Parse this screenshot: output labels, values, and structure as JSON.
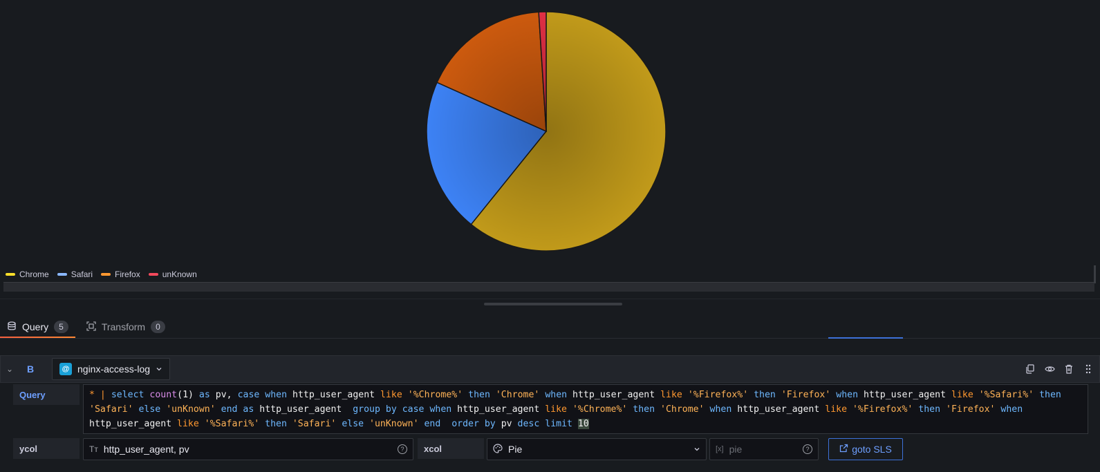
{
  "chart_data": {
    "type": "pie",
    "series": [
      {
        "name": "Chrome",
        "value": 60.8,
        "color": "#c19a1a"
      },
      {
        "name": "Safari",
        "value": 20.9,
        "color": "#3d82f5"
      },
      {
        "name": "Firefox",
        "value": 17.3,
        "color": "#cc5a0e"
      },
      {
        "name": "unKnown",
        "value": 1.0,
        "color": "#e02f44"
      }
    ],
    "legend": "bottom-left"
  },
  "legend": [
    {
      "label": "Chrome",
      "color": "#fade2a"
    },
    {
      "label": "Safari",
      "color": "#8ab8ff"
    },
    {
      "label": "Firefox",
      "color": "#ff9830"
    },
    {
      "label": "unKnown",
      "color": "#f2495c"
    }
  ],
  "tabs": {
    "query": {
      "label": "Query",
      "count": "5"
    },
    "transform": {
      "label": "Transform",
      "count": "0"
    }
  },
  "query_row": {
    "ref_id": "B",
    "datasource": "nginx-access-log",
    "datasource_logo": "@"
  },
  "fields": {
    "query_label": "Query",
    "ycol_label": "ycol",
    "ycol_value": "http_user_agent, pv",
    "xcol_label": "xcol",
    "xcol_value": "Pie",
    "extra_placeholder": "pie",
    "goto_label": "goto SLS"
  },
  "query_text": "* | select count(1) as pv, case when http_user_agent like '%Chrome%' then 'Chrome' when http_user_agent like '%Firefox%' then 'Firefox' when http_user_agent like '%Safari%' then 'Safari' else 'unKnown' end as http_user_agent  group by case when http_user_agent like '%Chrome%' then 'Chrome' when http_user_agent like '%Firefox%' then 'Firefox' when http_user_agent like '%Safari%' then 'Safari' else 'unKnown' end  order by pv desc limit 10",
  "icons": {
    "collapse": "chevron-down-icon",
    "duplicate": "copy-icon",
    "toggle": "eye-icon",
    "delete": "trash-icon",
    "drag": "drag-handle-icon",
    "ycol_type": "text-type-icon",
    "xcol_type": "palette-icon",
    "extra_type": "variable-icon",
    "goto": "external-link-icon"
  }
}
